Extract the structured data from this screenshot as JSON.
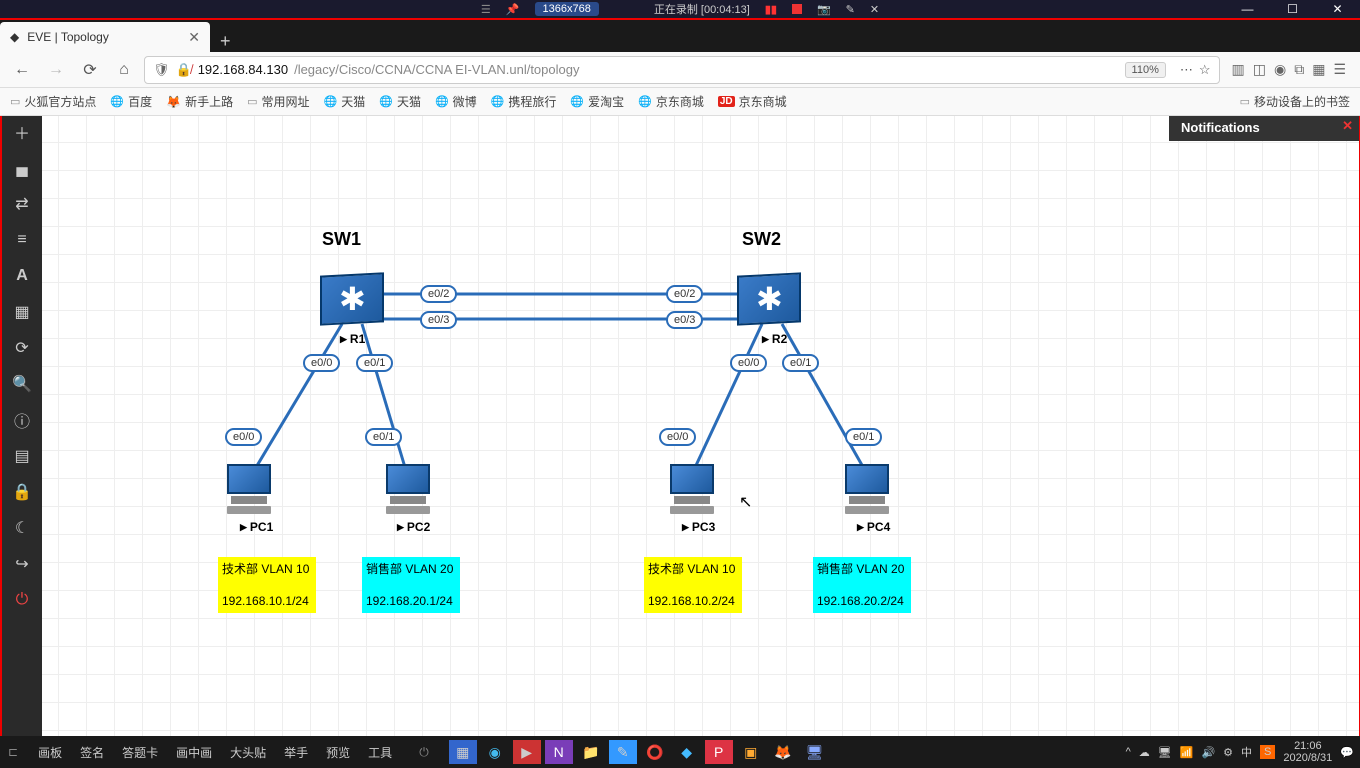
{
  "recording": {
    "dim": "1366x768",
    "status": "正在录制",
    "time": "[00:04:13]"
  },
  "browser": {
    "tab_title": "EVE | Topology",
    "url_host": "192.168.84.130",
    "url_path": "/legacy/Cisco/CCNA/CCNA EI-VLAN.unl/topology",
    "zoom": "110%",
    "bookmarks": [
      "火狐官方站点",
      "百度",
      "新手上路",
      "常用网址",
      "天猫",
      "天猫",
      "微博",
      "携程旅行",
      "爱淘宝",
      "京东商城",
      "京东商城"
    ],
    "mobile_bm": "移动设备上的书签"
  },
  "notifications": "Notifications",
  "switches": [
    {
      "title": "SW1",
      "label": "R1"
    },
    {
      "title": "SW2",
      "label": "R2"
    }
  ],
  "pcs": [
    {
      "label": "PC1"
    },
    {
      "label": "PC2"
    },
    {
      "label": "PC3"
    },
    {
      "label": "PC4"
    }
  ],
  "ports": {
    "sw1_e02": "e0/2",
    "sw1_e03": "e0/3",
    "sw2_e02": "e0/2",
    "sw2_e03": "e0/3",
    "sw1_e00": "e0/0",
    "sw1_e01": "e0/1",
    "sw2_e00": "e0/0",
    "sw2_e01": "e0/1",
    "pc1_e00": "e0/0",
    "pc2_e01": "e0/1",
    "pc3_e00": "e0/0",
    "pc4_e01": "e0/1"
  },
  "notes": [
    {
      "vlan": "技术部 VLAN 10",
      "ip": "192.168.10.1/24",
      "color": "yellow"
    },
    {
      "vlan": "销售部 VLAN 20",
      "ip": "192.168.20.1/24",
      "color": "cyan"
    },
    {
      "vlan": "技术部 VLAN 10",
      "ip": "192.168.10.2/24",
      "color": "yellow"
    },
    {
      "vlan": "销售部 VLAN 20",
      "ip": "192.168.20.2/24",
      "color": "cyan"
    }
  ],
  "taskbar": {
    "items": [
      "画板",
      "签名",
      "答题卡",
      "画中画",
      "大头贴",
      "举手",
      "预览",
      "工具"
    ],
    "time": "21:06",
    "date": "2020/8/31"
  }
}
